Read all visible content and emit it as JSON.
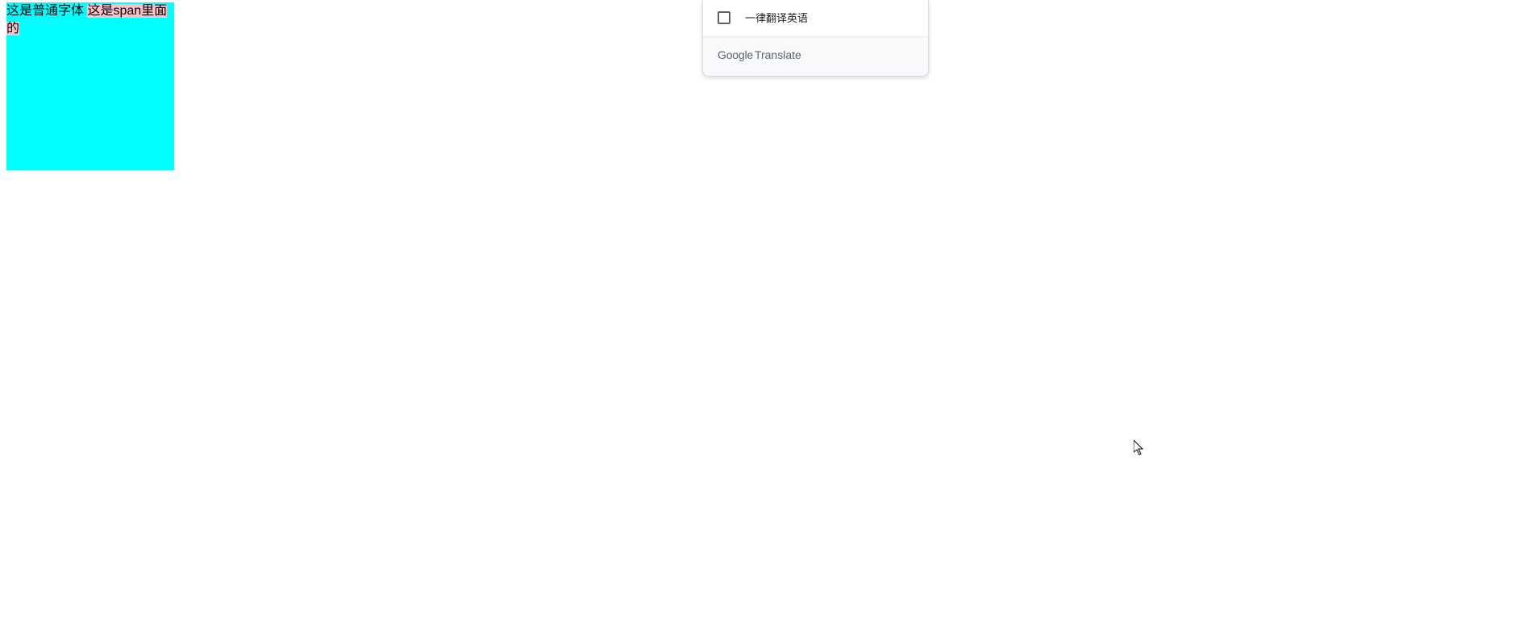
{
  "box": {
    "text_plain": "这是普通字体 ",
    "text_span": "这是span里面的"
  },
  "translate_popup": {
    "option_label": "一律翻译英语",
    "footer_logo_main": "Google",
    "footer_logo_sub": "Translate"
  }
}
